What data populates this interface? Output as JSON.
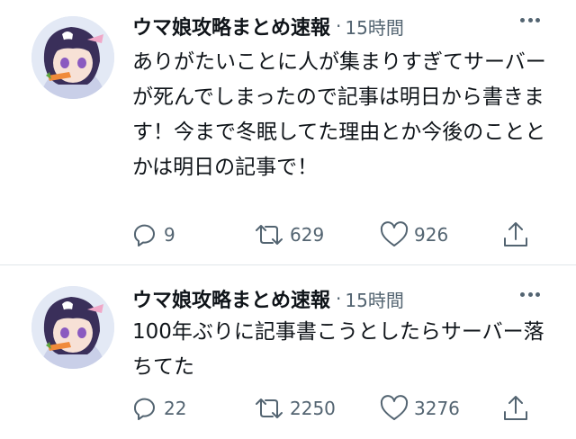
{
  "tweets": [
    {
      "author": "ウマ娘攻略まとめ速報",
      "separator": "·",
      "time": "15時間",
      "text": "ありがたいことに人が集まりすぎてサーバーが死んでしまったので記事は明日から書きます！今まで冬眠してた理由とか今後のこととかは明日の記事で！",
      "replies": "9",
      "retweets": "629",
      "likes": "926"
    },
    {
      "author": "ウマ娘攻略まとめ速報",
      "separator": "·",
      "time": "15時間",
      "text": "100年ぶりに記事書こうとしたらサーバー落ちてた",
      "replies": "22",
      "retweets": "2250",
      "likes": "3276"
    }
  ],
  "icons": {
    "avatar": "anime-character-avatar",
    "more": "more-dots-icon",
    "reply": "reply-bubble-icon",
    "retweet": "retweet-icon",
    "like": "heart-icon",
    "share": "share-upload-icon"
  },
  "colors": {
    "text": "#0f1419",
    "secondary": "#536471",
    "divider": "#e1e6ea"
  }
}
